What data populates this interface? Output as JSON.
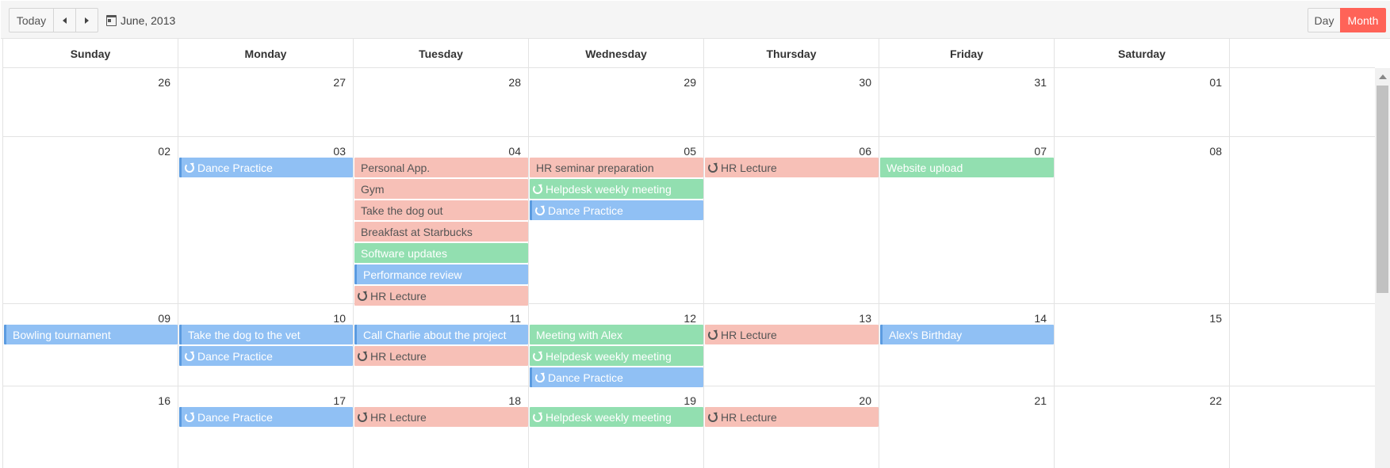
{
  "toolbar": {
    "today_label": "Today",
    "prev_icon": "triangle-left-icon",
    "next_icon": "triangle-right-icon",
    "date_icon": "calendar-icon",
    "current_period": "June, 2013",
    "view_day_label": "Day",
    "view_month_label": "Month",
    "active_view": "Month",
    "accent_color": "#ff6358"
  },
  "weekdays": [
    "Sunday",
    "Monday",
    "Tuesday",
    "Wednesday",
    "Thursday",
    "Friday",
    "Saturday"
  ],
  "colors": {
    "blue": "#90c0f4",
    "pink": "#f7c0b7",
    "green": "#92dfb0"
  },
  "weeks": [
    {
      "dates": [
        "26",
        "27",
        "28",
        "29",
        "30",
        "31",
        "01"
      ],
      "events": []
    },
    {
      "dates": [
        "02",
        "03",
        "04",
        "05",
        "06",
        "07",
        "08"
      ],
      "events": [
        {
          "day": 1,
          "slot": 0,
          "title": "Dance Practice",
          "color": "blue",
          "recurring": true
        },
        {
          "day": 2,
          "slot": 0,
          "title": "Personal App.",
          "color": "pink",
          "recurring": false
        },
        {
          "day": 2,
          "slot": 1,
          "title": "Gym",
          "color": "pink",
          "recurring": false
        },
        {
          "day": 2,
          "slot": 2,
          "title": "Take the dog out",
          "color": "pink",
          "recurring": false
        },
        {
          "day": 2,
          "slot": 3,
          "title": "Breakfast at Starbucks",
          "color": "pink",
          "recurring": false
        },
        {
          "day": 2,
          "slot": 4,
          "title": "Software updates",
          "color": "green",
          "recurring": false
        },
        {
          "day": 2,
          "slot": 5,
          "title": "Performance review",
          "color": "blue",
          "recurring": false
        },
        {
          "day": 2,
          "slot": 6,
          "title": "HR Lecture",
          "color": "pink",
          "recurring": true
        },
        {
          "day": 3,
          "slot": 0,
          "title": "HR seminar preparation",
          "color": "pink",
          "recurring": false
        },
        {
          "day": 3,
          "slot": 1,
          "title": "Helpdesk weekly meeting",
          "color": "green",
          "recurring": true
        },
        {
          "day": 3,
          "slot": 2,
          "title": "Dance Practice",
          "color": "blue",
          "recurring": true
        },
        {
          "day": 4,
          "slot": 0,
          "title": "HR Lecture",
          "color": "pink",
          "recurring": true
        },
        {
          "day": 5,
          "slot": 0,
          "title": "Website upload",
          "color": "green",
          "recurring": false
        }
      ]
    },
    {
      "dates": [
        "09",
        "10",
        "11",
        "12",
        "13",
        "14",
        "15"
      ],
      "events": [
        {
          "day": 0,
          "slot": 0,
          "title": "Bowling tournament",
          "color": "blue",
          "recurring": false
        },
        {
          "day": 1,
          "slot": 0,
          "title": "Take the dog to the vet",
          "color": "blue",
          "recurring": false
        },
        {
          "day": 1,
          "slot": 1,
          "title": "Dance Practice",
          "color": "blue",
          "recurring": true
        },
        {
          "day": 2,
          "slot": 0,
          "title": "Call Charlie about the project",
          "color": "blue",
          "recurring": false
        },
        {
          "day": 2,
          "slot": 1,
          "title": "HR Lecture",
          "color": "pink",
          "recurring": true
        },
        {
          "day": 3,
          "slot": 0,
          "title": "Meeting with Alex",
          "color": "green",
          "recurring": false
        },
        {
          "day": 3,
          "slot": 1,
          "title": "Helpdesk weekly meeting",
          "color": "green",
          "recurring": true
        },
        {
          "day": 3,
          "slot": 2,
          "title": "Dance Practice",
          "color": "blue",
          "recurring": true
        },
        {
          "day": 4,
          "slot": 0,
          "title": "HR Lecture",
          "color": "pink",
          "recurring": true
        },
        {
          "day": 5,
          "slot": 0,
          "title": "Alex's Birthday",
          "color": "blue",
          "recurring": false
        }
      ]
    },
    {
      "dates": [
        "16",
        "17",
        "18",
        "19",
        "20",
        "21",
        "22"
      ],
      "events": [
        {
          "day": 1,
          "slot": 0,
          "title": "Dance Practice",
          "color": "blue",
          "recurring": true
        },
        {
          "day": 2,
          "slot": 0,
          "title": "HR Lecture",
          "color": "pink",
          "recurring": true
        },
        {
          "day": 3,
          "slot": 0,
          "title": "Helpdesk weekly meeting",
          "color": "green",
          "recurring": true
        },
        {
          "day": 4,
          "slot": 0,
          "title": "HR Lecture",
          "color": "pink",
          "recurring": true
        }
      ]
    }
  ]
}
